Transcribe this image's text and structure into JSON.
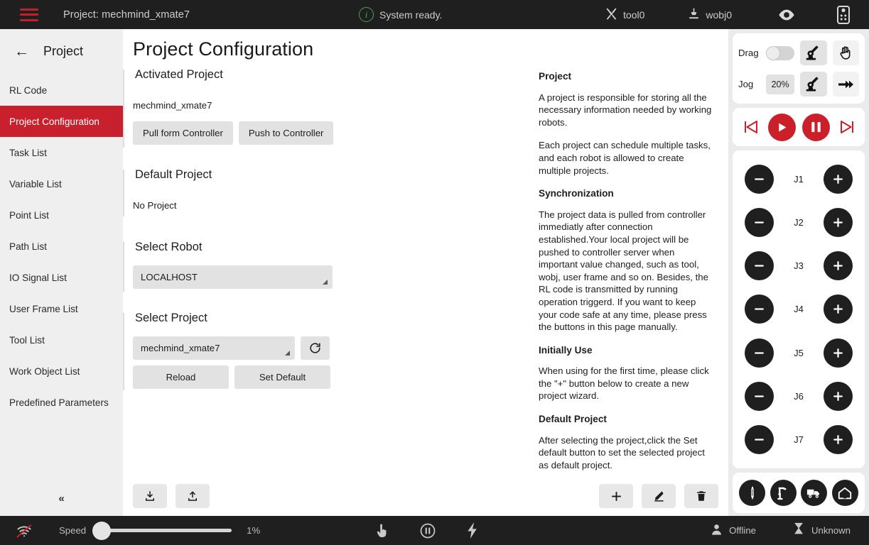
{
  "topbar": {
    "menu_icon": "hamburger-icon",
    "project_label": "Project: mechmind_xmate7",
    "status_icon": "info-circle-icon",
    "status_text": "System ready.",
    "tool_label": "tool0",
    "tool_icon": "tool-wrench-icon",
    "wobj_label": "wobj0",
    "wobj_icon": "work-object-icon",
    "eye_icon": "eye-icon",
    "teach_pendant_icon": "teach-pendant-icon",
    "background": "#1f1f1f",
    "accent": "#c0202c"
  },
  "sidebar": {
    "back_icon": "arrow-left-icon",
    "title": "Project",
    "collapse_icon": "double-chevron-left-icon",
    "active_color": "#c8202c",
    "items": [
      {
        "label": "RL Code",
        "active": false
      },
      {
        "label": "Project Configuration",
        "active": true
      },
      {
        "label": "Task List",
        "active": false
      },
      {
        "label": "Variable List",
        "active": false
      },
      {
        "label": "Point List",
        "active": false
      },
      {
        "label": "Path List",
        "active": false
      },
      {
        "label": "IO Signal List",
        "active": false
      },
      {
        "label": "User Frame List",
        "active": false
      },
      {
        "label": "Tool List",
        "active": false
      },
      {
        "label": "Work Object List",
        "active": false
      },
      {
        "label": "Predefined Parameters",
        "active": false
      }
    ]
  },
  "main": {
    "page_title": "Project Configuration",
    "activated_project": {
      "title": "Activated Project",
      "value": "mechmind_xmate7",
      "pull_button": "Pull form Controller",
      "push_button": "Push to Controller"
    },
    "default_project": {
      "title": "Default Project",
      "value": "No Project"
    },
    "select_robot": {
      "title": "Select Robot",
      "value": "LOCALHOST"
    },
    "select_project": {
      "title": "Select Project",
      "value": "mechmind_xmate7",
      "refresh_icon": "refresh-icon",
      "reload_button": "Reload",
      "set_default_button": "Set Default"
    },
    "footer": {
      "import_icon": "download-import-icon",
      "export_icon": "upload-export-icon",
      "add_icon": "plus-icon",
      "edit_icon": "pencil-edit-icon",
      "delete_icon": "trash-delete-icon"
    }
  },
  "help": [
    {
      "heading": "Project",
      "paragraphs": [
        "A project is responsible for storing all the necessary information needed by working robots.",
        "Each project can schedule multiple tasks, and each robot is allowed to create multiple projects."
      ]
    },
    {
      "heading": "Synchronization",
      "paragraphs": [
        "The project data is pulled from controller immediatly after connection established.Your local project will be pushed to controller server when important value changed, such as tool, wobj, user frame and so on. Besides, the RL code is transmitted by running operation triggerd. If you want to keep your code safe at any time, please press the buttons in this page manually."
      ]
    },
    {
      "heading": "Initially Use",
      "paragraphs": [
        "When using for the first time, please click the \"+\" button below to create a new project wizard."
      ]
    },
    {
      "heading": "Default Project",
      "paragraphs": [
        "After selecting the project,click the Set default button to set the selected project as default project."
      ]
    }
  ],
  "rightpanel": {
    "drag_label": "Drag",
    "drag_enabled": false,
    "drag_robot_icon": "robot-arm-icon",
    "drag_hand_icon": "hand-drag-icon",
    "jog_label": "Jog",
    "jog_percent": "20%",
    "jog_robot_icon": "robot-arm-icon",
    "jog_arrow_icon": "fast-forward-arrow-icon",
    "playback": {
      "prev_icon": "skip-previous-icon",
      "play_icon": "play-icon",
      "pause_icon": "pause-icon",
      "next_icon": "skip-next-icon",
      "accent": "#cb2029"
    },
    "joints": [
      {
        "label": "J1",
        "minus_icon": "minus-icon",
        "plus_icon": "plus-icon"
      },
      {
        "label": "J2",
        "minus_icon": "minus-icon",
        "plus_icon": "plus-icon"
      },
      {
        "label": "J3",
        "minus_icon": "minus-icon",
        "plus_icon": "plus-icon"
      },
      {
        "label": "J4",
        "minus_icon": "minus-icon",
        "plus_icon": "plus-icon"
      },
      {
        "label": "J5",
        "minus_icon": "minus-icon",
        "plus_icon": "plus-icon"
      },
      {
        "label": "J6",
        "minus_icon": "minus-icon",
        "plus_icon": "plus-icon"
      },
      {
        "label": "J7",
        "minus_icon": "minus-icon",
        "plus_icon": "plus-icon"
      }
    ],
    "quick_actions": [
      {
        "icon": "tool-pen-icon"
      },
      {
        "icon": "robot-arm-icon"
      },
      {
        "icon": "truck-transport-icon"
      },
      {
        "icon": "home-icon"
      }
    ]
  },
  "bottombar": {
    "wifi_icon": "wifi-off-icon",
    "speed_label": "Speed",
    "speed_value": "1%",
    "speed_percent": 1,
    "hand_icon": "hand-pointer-icon",
    "pause_icon": "pause-circle-icon",
    "power_icon": "lightning-power-icon",
    "user_icon": "user-icon",
    "user_status": "Offline",
    "robot_icon": "robot-status-icon",
    "robot_status": "Unknown"
  }
}
